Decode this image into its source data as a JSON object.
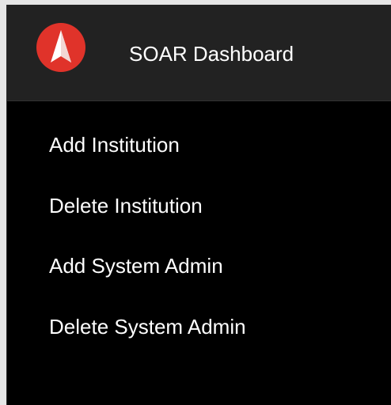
{
  "header": {
    "logo_icon": "soar-arrow-logo-icon",
    "brand_color": "#e0332a",
    "title": "SOAR Dashboard"
  },
  "menu": {
    "items": [
      {
        "label": "Add Institution"
      },
      {
        "label": "Delete Institution"
      },
      {
        "label": "Add System Admin"
      },
      {
        "label": "Delete System Admin"
      }
    ]
  }
}
